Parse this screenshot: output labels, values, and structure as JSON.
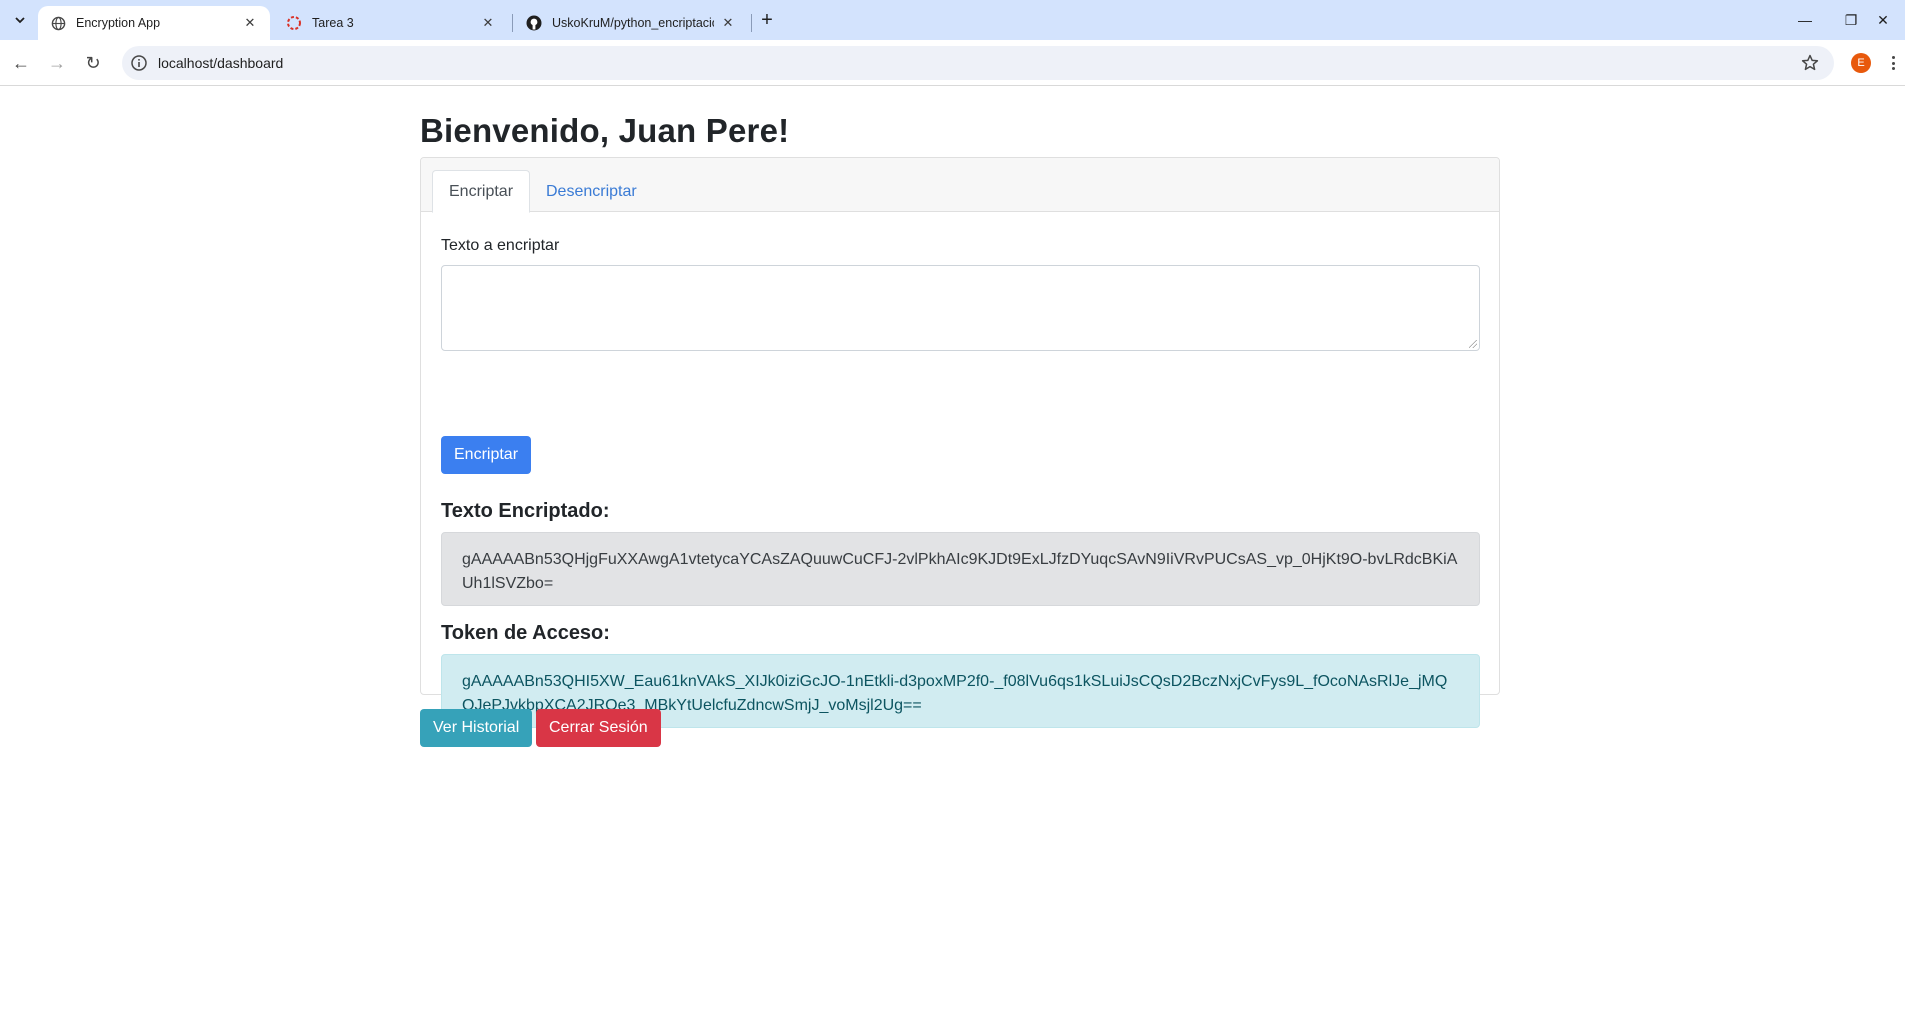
{
  "browser": {
    "tabs": [
      {
        "title": "Encryption App",
        "icon": "globe-icon",
        "active": true
      },
      {
        "title": "Tarea 3",
        "icon": "spinner-icon",
        "active": false
      },
      {
        "title": "UskoKruM/python_encriptacion",
        "icon": "github-icon",
        "active": false
      }
    ],
    "url": "localhost/dashboard",
    "profile_initial": "E",
    "new_tab_label": "+"
  },
  "page": {
    "welcome": "Bienvenido, Juan Pere!",
    "tabs": {
      "encrypt": "Encriptar",
      "decrypt": "Desencriptar"
    },
    "form": {
      "label": "Texto a encriptar",
      "value": "",
      "submit": "Encriptar"
    },
    "encrypted": {
      "heading": "Texto Encriptado:",
      "value": "gAAAAABn53QHjgFuXXAwgA1vtetycaYCAsZAQuuwCuCFJ-2vlPkhAIc9KJDt9ExLJfzDYuqcSAvN9IiVRvPUCsAS_vp_0HjKt9O-bvLRdcBKiAUh1lSVZbo="
    },
    "token": {
      "heading": "Token de Acceso:",
      "value": "gAAAAABn53QHI5XW_Eau61knVAkS_XIJk0iziGcJO-1nEtkli-d3poxMP2f0-_f08lVu6qs1kSLuiJsCQsD2BczNxjCvFys9L_fOcoNAsRlJe_jMQQJePJvkbpXCA2JROe3_MBkYtUelcfuZdncwSmjJ_voMsjl2Ug=="
    },
    "actions": {
      "history": "Ver Historial",
      "logout": "Cerrar Sesión"
    }
  },
  "colors": {
    "primary": "#3b7ff0",
    "info": "#36a2b9",
    "danger": "#d93646",
    "tabstrip": "#d3e3fd"
  }
}
